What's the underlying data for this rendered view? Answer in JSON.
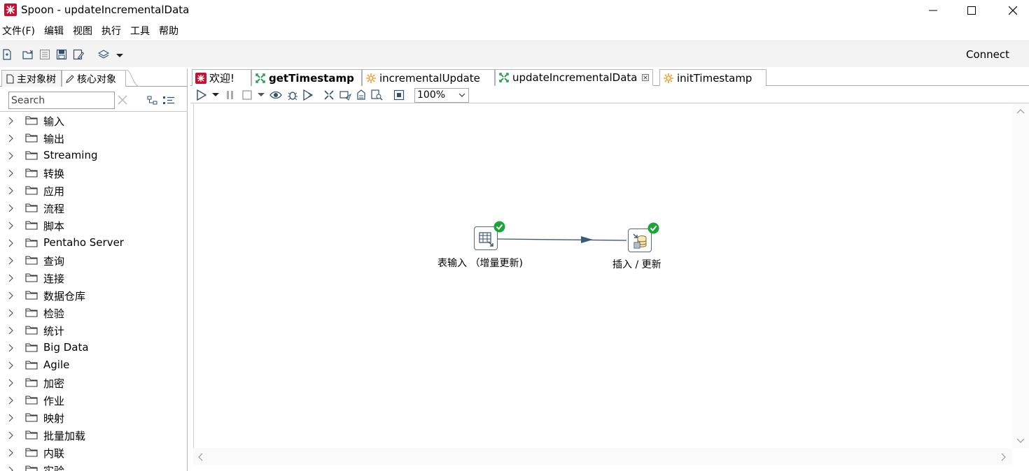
{
  "window": {
    "title": "Spoon - updateIncrementalData"
  },
  "menu": [
    {
      "label": "文件(F)"
    },
    {
      "label": "编辑"
    },
    {
      "label": "视图"
    },
    {
      "label": "执行"
    },
    {
      "label": "工具"
    },
    {
      "label": "帮助"
    }
  ],
  "toolbar": {
    "connect_label": "Connect"
  },
  "left_panel": {
    "tabs": [
      {
        "label": "主对象树",
        "icon": "document-icon"
      },
      {
        "label": "核心对象",
        "icon": "pencil-icon"
      }
    ],
    "search_placeholder": "Search",
    "tree_items": [
      {
        "label": "输入"
      },
      {
        "label": "输出"
      },
      {
        "label": "Streaming"
      },
      {
        "label": "转换"
      },
      {
        "label": "应用"
      },
      {
        "label": "流程"
      },
      {
        "label": "脚本"
      },
      {
        "label": "Pentaho Server"
      },
      {
        "label": "查询"
      },
      {
        "label": "连接"
      },
      {
        "label": "数据仓库"
      },
      {
        "label": "检验"
      },
      {
        "label": "统计"
      },
      {
        "label": "Big Data"
      },
      {
        "label": "Agile"
      },
      {
        "label": "加密"
      },
      {
        "label": "作业"
      },
      {
        "label": "映射"
      },
      {
        "label": "批量加载"
      },
      {
        "label": "内联"
      },
      {
        "label": "实验"
      }
    ]
  },
  "file_tabs": [
    {
      "label": "欢迎!",
      "icon": "spoon-icon",
      "bold": false,
      "active": false
    },
    {
      "label": "getTimestamp",
      "icon": "transformation-icon",
      "bold": true,
      "active": false
    },
    {
      "label": "incrementalUpdate",
      "icon": "job-icon",
      "bold": false,
      "active": false
    },
    {
      "label": "updateIncrementalData",
      "icon": "transformation-icon",
      "bold": false,
      "active": true
    },
    {
      "label": "initTimestamp",
      "icon": "job-icon",
      "bold": false,
      "active": false
    }
  ],
  "canvas_toolbar": {
    "zoom": "100%"
  },
  "canvas": {
    "steps": [
      {
        "label": "表输入 （增量更新)",
        "icon": "table-input-icon",
        "status": "ok"
      },
      {
        "label": "插入 / 更新",
        "icon": "insert-update-icon",
        "status": "ok"
      }
    ],
    "hop_color": "#3c5a78",
    "ok_color": "#1aa538"
  },
  "colors": {
    "spoon_red": "#c8102e",
    "transform_green": "#2e9e4f",
    "job_orange": "#f0a030"
  }
}
